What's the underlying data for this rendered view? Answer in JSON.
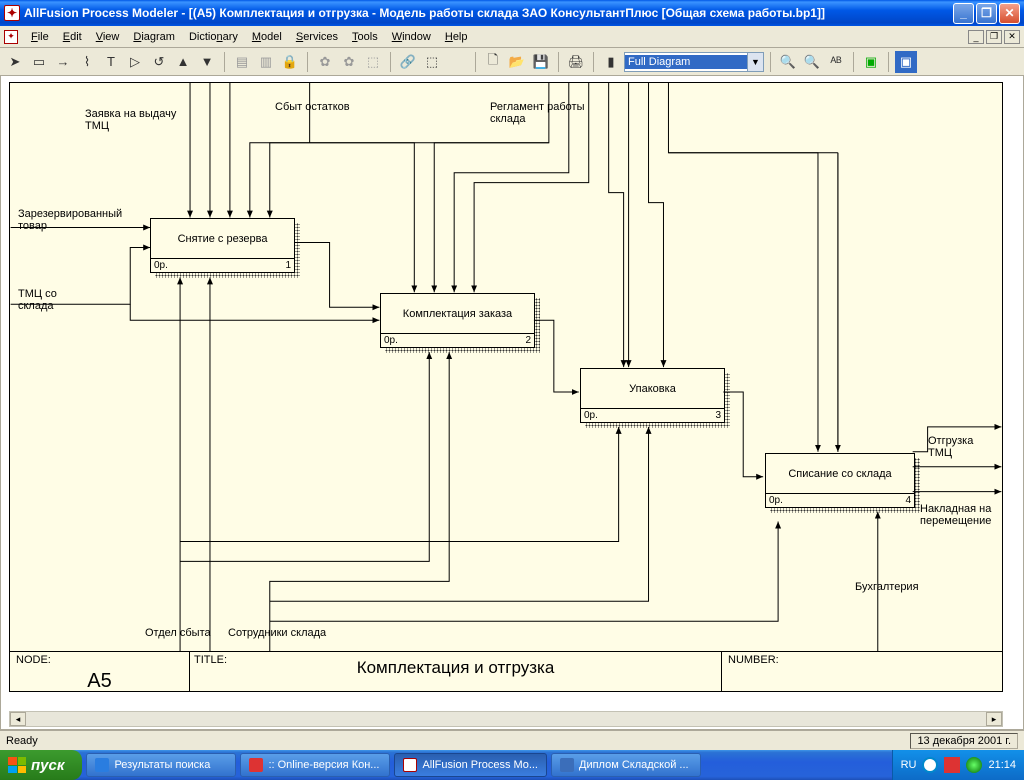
{
  "window": {
    "title": "AllFusion Process Modeler - [(А5) Комплектация и отгрузка - Модель работы склада ЗАО КонсультантПлюс [Общая схема работы.bp1]]"
  },
  "menu": {
    "file": "File",
    "edit": "Edit",
    "view": "View",
    "diagram": "Diagram",
    "dictionary": "Dictionary",
    "model": "Model",
    "services": "Services",
    "tools": "Tools",
    "window": "Window",
    "help": "Help"
  },
  "toolbar": {
    "zoom_combo": "Full Diagram"
  },
  "diagram": {
    "labels": {
      "top1": "Заявка на выдачу ТМЦ",
      "top2": "Сбыт остатков",
      "top3": "Регламент работы склада",
      "left1": "Зарезервированный товар",
      "left2": "ТМЦ со склада",
      "right1": "Отгрузка ТМЦ",
      "right2": "Накладная на перемещение",
      "bottom1": "Отдел сбыта",
      "bottom2": "Сотрудники склада",
      "bottom3": "Бухгалтерия"
    },
    "box1": {
      "title": "Снятие с резерва",
      "cost": "0р.",
      "num": "1"
    },
    "box2": {
      "title": "Комплектация заказа",
      "cost": "0р.",
      "num": "2"
    },
    "box3": {
      "title": "Упаковка",
      "cost": "0р.",
      "num": "3"
    },
    "box4": {
      "title": "Списание со склада",
      "cost": "0р.",
      "num": "4"
    }
  },
  "footer": {
    "node_label": "NODE:",
    "node_value": "А5",
    "title_label": "TITLE:",
    "title_value": "Комплектация и отгрузка",
    "number_label": "NUMBER:"
  },
  "status": {
    "ready": "Ready",
    "date": "13 декабря 2001 г."
  },
  "taskbar": {
    "start": "пуск",
    "t1": "Результаты поиска",
    "t2": ":: Online-версия Кон...",
    "t3": "AllFusion Process Mo...",
    "t4": "Диплом Складской ...",
    "lang": "RU",
    "clock": "21:14"
  }
}
